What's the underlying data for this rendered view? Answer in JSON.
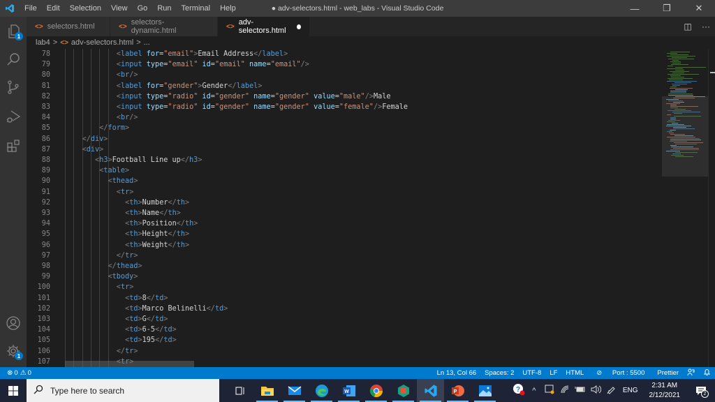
{
  "titlebar": {
    "menu": [
      "File",
      "Edit",
      "Selection",
      "View",
      "Go",
      "Run",
      "Terminal",
      "Help"
    ],
    "title": "● adv-selectors.html - web_labs - Visual Studio Code",
    "minimize": "—",
    "restore": "❐",
    "close": "✕"
  },
  "activitybar": {
    "explorer_badge": "1",
    "settings_badge": "1"
  },
  "tabs": [
    {
      "label": "selectors.html",
      "active": false
    },
    {
      "label": "selectors-dynamic.html",
      "active": false
    },
    {
      "label": "adv-selectors.html",
      "active": true,
      "dirty": true
    }
  ],
  "tab_actions": {
    "split": "◫",
    "more": "···"
  },
  "breadcrumb": {
    "folder": "lab4",
    "sep": ">",
    "file": "adv-selectors.html",
    "tail": "..."
  },
  "editor": {
    "lines": [
      {
        "n": "78",
        "indent": 12,
        "tokens": [
          [
            "br",
            "<"
          ],
          [
            "tag",
            "label"
          ],
          [
            "txt",
            " "
          ],
          [
            "attr",
            "for"
          ],
          [
            "txt",
            "="
          ],
          [
            "str",
            "\"email\""
          ],
          [
            "br",
            ">"
          ],
          [
            "txt",
            "Email Address"
          ],
          [
            "br",
            "</"
          ],
          [
            "tag",
            "label"
          ],
          [
            "br",
            ">"
          ]
        ]
      },
      {
        "n": "79",
        "indent": 12,
        "tokens": [
          [
            "br",
            "<"
          ],
          [
            "tag",
            "input"
          ],
          [
            "txt",
            " "
          ],
          [
            "attr",
            "type"
          ],
          [
            "txt",
            "="
          ],
          [
            "str",
            "\"email\""
          ],
          [
            "txt",
            " "
          ],
          [
            "attr",
            "id"
          ],
          [
            "txt",
            "="
          ],
          [
            "str",
            "\"email\""
          ],
          [
            "txt",
            " "
          ],
          [
            "attr",
            "name"
          ],
          [
            "txt",
            "="
          ],
          [
            "str",
            "\"email\""
          ],
          [
            "br",
            "/>"
          ]
        ]
      },
      {
        "n": "80",
        "indent": 12,
        "tokens": [
          [
            "br",
            "<"
          ],
          [
            "tag",
            "br"
          ],
          [
            "br",
            "/>"
          ]
        ]
      },
      {
        "n": "81",
        "indent": 12,
        "tokens": [
          [
            "br",
            "<"
          ],
          [
            "tag",
            "label"
          ],
          [
            "txt",
            " "
          ],
          [
            "attr",
            "for"
          ],
          [
            "txt",
            "="
          ],
          [
            "str",
            "\"gender\""
          ],
          [
            "br",
            ">"
          ],
          [
            "txt",
            "Gender"
          ],
          [
            "br",
            "</"
          ],
          [
            "tag",
            "label"
          ],
          [
            "br",
            ">"
          ]
        ]
      },
      {
        "n": "82",
        "indent": 12,
        "tokens": [
          [
            "br",
            "<"
          ],
          [
            "tag",
            "input"
          ],
          [
            "txt",
            " "
          ],
          [
            "attr",
            "type"
          ],
          [
            "txt",
            "="
          ],
          [
            "str",
            "\"radio\""
          ],
          [
            "txt",
            " "
          ],
          [
            "attr",
            "id"
          ],
          [
            "txt",
            "="
          ],
          [
            "str",
            "\"gender\""
          ],
          [
            "txt",
            " "
          ],
          [
            "attr",
            "name"
          ],
          [
            "txt",
            "="
          ],
          [
            "str",
            "\"gender\""
          ],
          [
            "txt",
            " "
          ],
          [
            "attr",
            "value"
          ],
          [
            "txt",
            "="
          ],
          [
            "str",
            "\"male\""
          ],
          [
            "br",
            "/>"
          ],
          [
            "txt",
            "Male"
          ]
        ]
      },
      {
        "n": "83",
        "indent": 12,
        "tokens": [
          [
            "br",
            "<"
          ],
          [
            "tag",
            "input"
          ],
          [
            "txt",
            " "
          ],
          [
            "attr",
            "type"
          ],
          [
            "txt",
            "="
          ],
          [
            "str",
            "\"radio\""
          ],
          [
            "txt",
            " "
          ],
          [
            "attr",
            "id"
          ],
          [
            "txt",
            "="
          ],
          [
            "str",
            "\"gender\""
          ],
          [
            "txt",
            " "
          ],
          [
            "attr",
            "name"
          ],
          [
            "txt",
            "="
          ],
          [
            "str",
            "\"gender\""
          ],
          [
            "txt",
            " "
          ],
          [
            "attr",
            "value"
          ],
          [
            "txt",
            "="
          ],
          [
            "str",
            "\"female\""
          ],
          [
            "br",
            "/>"
          ],
          [
            "txt",
            "Female"
          ]
        ]
      },
      {
        "n": "84",
        "indent": 12,
        "tokens": [
          [
            "br",
            "<"
          ],
          [
            "tag",
            "br"
          ],
          [
            "br",
            "/>"
          ]
        ]
      },
      {
        "n": "85",
        "indent": 8,
        "tokens": [
          [
            "br",
            "</"
          ],
          [
            "tag",
            "form"
          ],
          [
            "br",
            ">"
          ]
        ]
      },
      {
        "n": "86",
        "indent": 4,
        "tokens": [
          [
            "br",
            "</"
          ],
          [
            "tag",
            "div"
          ],
          [
            "br",
            ">"
          ]
        ]
      },
      {
        "n": "87",
        "indent": 4,
        "tokens": [
          [
            "br",
            "<"
          ],
          [
            "tag",
            "div"
          ],
          [
            "br",
            ">"
          ]
        ]
      },
      {
        "n": "88",
        "indent": 7,
        "tokens": [
          [
            "br",
            "<"
          ],
          [
            "tag",
            "h3"
          ],
          [
            "br",
            ">"
          ],
          [
            "txt",
            "Football Line up"
          ],
          [
            "br",
            "</"
          ],
          [
            "tag",
            "h3"
          ],
          [
            "br",
            ">"
          ]
        ]
      },
      {
        "n": "89",
        "indent": 8,
        "tokens": [
          [
            "br",
            "<"
          ],
          [
            "tag",
            "table"
          ],
          [
            "br",
            ">"
          ]
        ]
      },
      {
        "n": "90",
        "indent": 10,
        "tokens": [
          [
            "br",
            "<"
          ],
          [
            "tag",
            "thead"
          ],
          [
            "br",
            ">"
          ]
        ]
      },
      {
        "n": "91",
        "indent": 12,
        "tokens": [
          [
            "br",
            "<"
          ],
          [
            "tag",
            "tr"
          ],
          [
            "br",
            ">"
          ]
        ]
      },
      {
        "n": "92",
        "indent": 14,
        "tokens": [
          [
            "br",
            "<"
          ],
          [
            "tag",
            "th"
          ],
          [
            "br",
            ">"
          ],
          [
            "txt",
            "Number"
          ],
          [
            "br",
            "</"
          ],
          [
            "tag",
            "th"
          ],
          [
            "br",
            ">"
          ]
        ]
      },
      {
        "n": "93",
        "indent": 14,
        "tokens": [
          [
            "br",
            "<"
          ],
          [
            "tag",
            "th"
          ],
          [
            "br",
            ">"
          ],
          [
            "txt",
            "Name"
          ],
          [
            "br",
            "</"
          ],
          [
            "tag",
            "th"
          ],
          [
            "br",
            ">"
          ]
        ]
      },
      {
        "n": "94",
        "indent": 14,
        "tokens": [
          [
            "br",
            "<"
          ],
          [
            "tag",
            "th"
          ],
          [
            "br",
            ">"
          ],
          [
            "txt",
            "Position"
          ],
          [
            "br",
            "</"
          ],
          [
            "tag",
            "th"
          ],
          [
            "br",
            ">"
          ]
        ]
      },
      {
        "n": "95",
        "indent": 14,
        "tokens": [
          [
            "br",
            "<"
          ],
          [
            "tag",
            "th"
          ],
          [
            "br",
            ">"
          ],
          [
            "txt",
            "Height"
          ],
          [
            "br",
            "</"
          ],
          [
            "tag",
            "th"
          ],
          [
            "br",
            ">"
          ]
        ]
      },
      {
        "n": "96",
        "indent": 14,
        "tokens": [
          [
            "br",
            "<"
          ],
          [
            "tag",
            "th"
          ],
          [
            "br",
            ">"
          ],
          [
            "txt",
            "Weight"
          ],
          [
            "br",
            "</"
          ],
          [
            "tag",
            "th"
          ],
          [
            "br",
            ">"
          ]
        ]
      },
      {
        "n": "97",
        "indent": 12,
        "tokens": [
          [
            "br",
            "</"
          ],
          [
            "tag",
            "tr"
          ],
          [
            "br",
            ">"
          ]
        ]
      },
      {
        "n": "98",
        "indent": 10,
        "tokens": [
          [
            "br",
            "</"
          ],
          [
            "tag",
            "thead"
          ],
          [
            "br",
            ">"
          ]
        ]
      },
      {
        "n": "99",
        "indent": 10,
        "tokens": [
          [
            "br",
            "<"
          ],
          [
            "tag",
            "tbody"
          ],
          [
            "br",
            ">"
          ]
        ]
      },
      {
        "n": "100",
        "indent": 12,
        "tokens": [
          [
            "br",
            "<"
          ],
          [
            "tag",
            "tr"
          ],
          [
            "br",
            ">"
          ]
        ]
      },
      {
        "n": "101",
        "indent": 14,
        "tokens": [
          [
            "br",
            "<"
          ],
          [
            "tag",
            "td"
          ],
          [
            "br",
            ">"
          ],
          [
            "txt",
            "8"
          ],
          [
            "br",
            "</"
          ],
          [
            "tag",
            "td"
          ],
          [
            "br",
            ">"
          ]
        ]
      },
      {
        "n": "102",
        "indent": 14,
        "tokens": [
          [
            "br",
            "<"
          ],
          [
            "tag",
            "td"
          ],
          [
            "br",
            ">"
          ],
          [
            "txt",
            "Marco Belinelli"
          ],
          [
            "br",
            "</"
          ],
          [
            "tag",
            "td"
          ],
          [
            "br",
            ">"
          ]
        ]
      },
      {
        "n": "103",
        "indent": 14,
        "tokens": [
          [
            "br",
            "<"
          ],
          [
            "tag",
            "td"
          ],
          [
            "br",
            ">"
          ],
          [
            "txt",
            "G"
          ],
          [
            "br",
            "</"
          ],
          [
            "tag",
            "td"
          ],
          [
            "br",
            ">"
          ]
        ]
      },
      {
        "n": "104",
        "indent": 14,
        "tokens": [
          [
            "br",
            "<"
          ],
          [
            "tag",
            "td"
          ],
          [
            "br",
            ">"
          ],
          [
            "txt",
            "6-5"
          ],
          [
            "br",
            "</"
          ],
          [
            "tag",
            "td"
          ],
          [
            "br",
            ">"
          ]
        ]
      },
      {
        "n": "105",
        "indent": 14,
        "tokens": [
          [
            "br",
            "<"
          ],
          [
            "tag",
            "td"
          ],
          [
            "br",
            ">"
          ],
          [
            "txt",
            "195"
          ],
          [
            "br",
            "</"
          ],
          [
            "tag",
            "td"
          ],
          [
            "br",
            ">"
          ]
        ]
      },
      {
        "n": "106",
        "indent": 12,
        "tokens": [
          [
            "br",
            "</"
          ],
          [
            "tag",
            "tr"
          ],
          [
            "br",
            ">"
          ]
        ]
      },
      {
        "n": "107",
        "indent": 12,
        "tokens": [
          [
            "br",
            "<"
          ],
          [
            "tag",
            "tr"
          ],
          [
            "br",
            ">"
          ]
        ]
      }
    ]
  },
  "statusbar": {
    "errors": "0",
    "warnings": "0",
    "position": "Ln 13, Col 66",
    "spaces": "Spaces: 2",
    "encoding": "UTF-8",
    "eol": "LF",
    "language": "HTML",
    "port": "Port : 5500",
    "formatter": "Prettier"
  },
  "taskbar": {
    "search_placeholder": "Type here to search",
    "time": "2:31 AM",
    "date": "2/12/2021",
    "language": "ENG",
    "notifications": "2"
  },
  "colors": {
    "accent": "#007acc",
    "tag": "#569cd6",
    "attr": "#9cdcfe",
    "string": "#ce9178"
  }
}
